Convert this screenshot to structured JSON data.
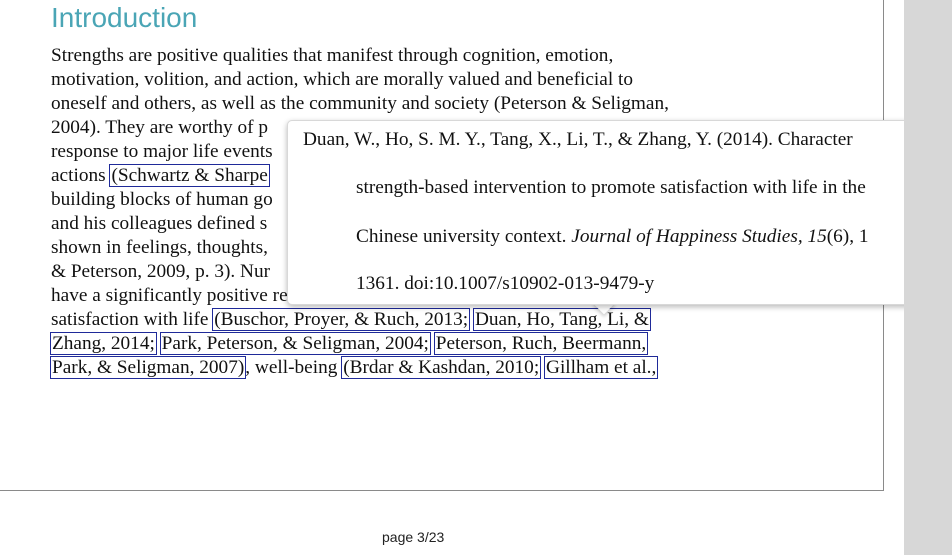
{
  "document": {
    "heading": "Introduction",
    "lines": [
      {
        "text": "Strengths are positive qualities that manifest through cognition, emotion,"
      },
      {
        "text": "motivation, volition, and action, which are morally valued and beneficial to"
      },
      {
        "text": "oneself and others, as well as the community and society (Peterson & Seligman,"
      },
      {
        "text": "2004). They are worthy of p"
      },
      {
        "text": "response to major life events"
      },
      {
        "pre": "actions ",
        "cite": "(Schwartz & Sharpe"
      },
      {
        "text": "building blocks of human go"
      },
      {
        "text": "and his colleagues defined s"
      },
      {
        "text": "shown in feelings, thoughts,"
      },
      {
        "text": "& Peterson, 2009, p. 3). Nur"
      },
      {
        "text": "have a significantly positive relationship with mental health outcomes, such as"
      }
    ],
    "line12": {
      "pre": "satisfaction with life ",
      "cite1": "(Buschor, Proyer, & Ruch, 2013;",
      "cite2": "Duan, Ho, Tang, Li, &"
    },
    "line13": {
      "cite1": "Zhang, 2014;",
      "cite2": "Park, Peterson, & Seligman, 2004;",
      "cite3": "Peterson, Ruch, Beermann,"
    },
    "line14": {
      "cite1": "Park, & Seligman, 2007)",
      "mid": ", well-being ",
      "cite2": "(Brdar & Kashdan, 2010;",
      "cite3": "Gillham et al.,"
    }
  },
  "popup": {
    "line1": "Duan, W., Ho, S. M. Y., Tang, X., Li, T., & Zhang, Y. (2014). Character",
    "line2": "strength-based intervention to promote satisfaction with life in the",
    "line3_pre": "Chinese university context. ",
    "line3_journal": "Journal of Happiness Studies, 15",
    "line3_post": "(6), 1",
    "line4": "1361. doi:10.1007/s10902-013-9479-y"
  },
  "footer": {
    "page_indicator": "page 3/23"
  }
}
